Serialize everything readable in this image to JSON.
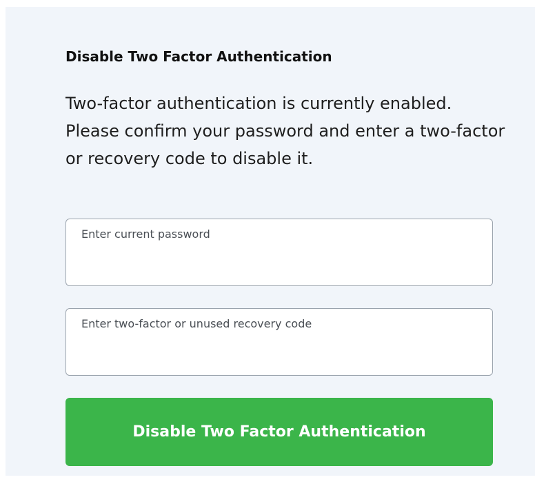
{
  "panel": {
    "title": "Disable Two Factor Authentication",
    "description": "Two-factor authentication is currently enabled. Please confirm your password and enter a two-factor or recovery code to disable it."
  },
  "form": {
    "password_label": "Enter current password",
    "password_value": "",
    "code_label": "Enter two-factor or unused recovery code",
    "code_value": "",
    "submit_label": "Disable Two Factor Authentication"
  },
  "colors": {
    "panel_background": "#f1f5fa",
    "button_background": "#3bb54a",
    "button_text": "#ffffff",
    "field_border": "#9aa3ad"
  }
}
